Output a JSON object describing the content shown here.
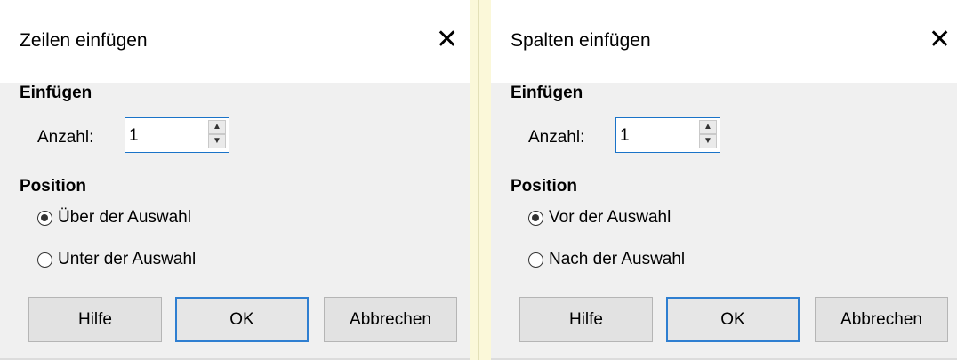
{
  "left_dialog": {
    "title": "Zeilen einfügen",
    "close_glyph": "✕",
    "section_insert": "Einfügen",
    "count_label": "Anzahl:",
    "count_value": "1",
    "section_position": "Position",
    "option_1": "Über der Auswahl",
    "option_1_checked": true,
    "option_2": "Unter der Auswahl",
    "option_2_checked": false,
    "help_label": "Hilfe",
    "ok_label": "OK",
    "cancel_label": "Abbrechen"
  },
  "right_dialog": {
    "title": "Spalten einfügen",
    "close_glyph": "✕",
    "section_insert": "Einfügen",
    "count_label": "Anzahl:",
    "count_value": "1",
    "section_position": "Position",
    "option_1": "Vor der Auswahl",
    "option_1_checked": true,
    "option_2": "Nach der Auswahl",
    "option_2_checked": false,
    "help_label": "Hilfe",
    "ok_label": "OK",
    "cancel_label": "Abbrechen"
  },
  "icons": {
    "close": "close-icon",
    "spin_up": "chevron-up-icon",
    "spin_down": "chevron-down-icon"
  },
  "colors": {
    "accent": "#2f7fd1",
    "dialog_bg": "#f0f0f0",
    "desktop_bg": "#fbf8d9"
  }
}
